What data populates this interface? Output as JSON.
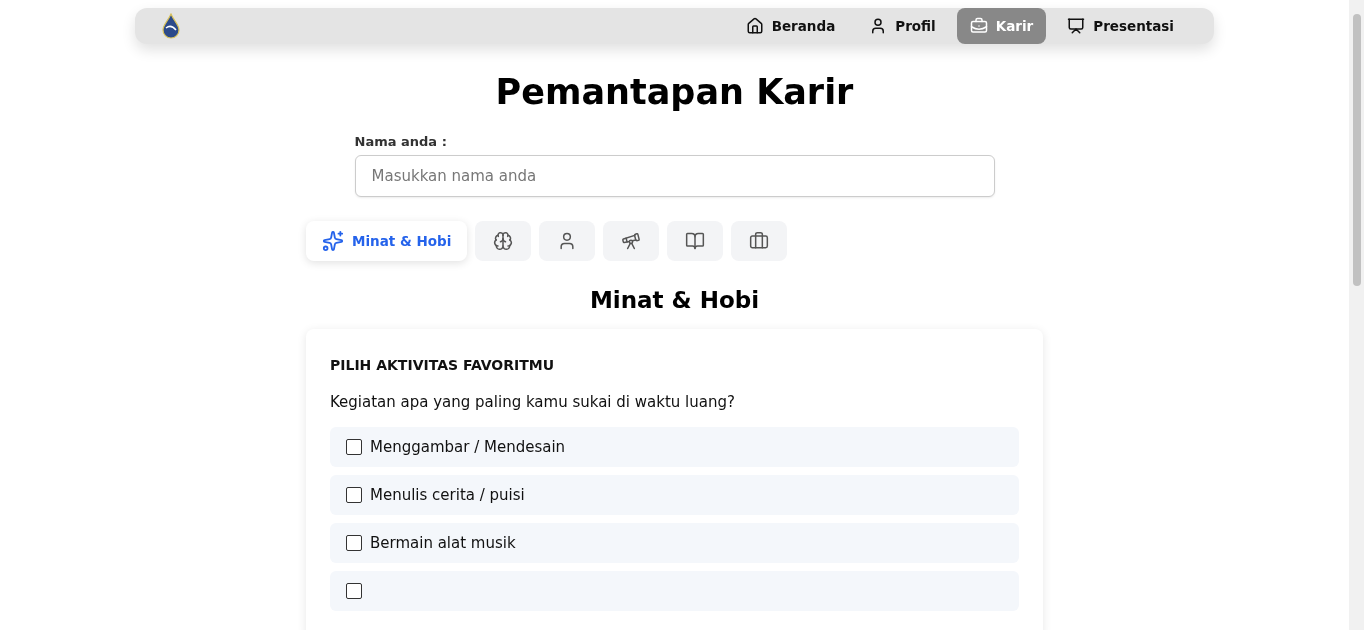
{
  "nav": {
    "items": [
      {
        "label": "Beranda",
        "selected": false
      },
      {
        "label": "Profil",
        "selected": false
      },
      {
        "label": "Karir",
        "selected": true
      },
      {
        "label": "Presentasi",
        "selected": false
      }
    ]
  },
  "title": "Pemantapan Karir",
  "name_field": {
    "label": "Nama anda :",
    "placeholder": "Masukkan nama anda"
  },
  "tabs": [
    {
      "label": "Minat & Hobi",
      "selected": true
    },
    {
      "selected": false
    },
    {
      "selected": false
    },
    {
      "selected": false
    },
    {
      "selected": false
    },
    {
      "selected": false
    }
  ],
  "section_title": "Minat & Hobi",
  "card": {
    "heading": "PILIH AKTIVITAS FAVORITMU",
    "question": "Kegiatan apa yang paling kamu sukai di waktu luang?",
    "options": [
      {
        "label": "Menggambar / Mendesain",
        "checked": false
      },
      {
        "label": "Menulis cerita / puisi",
        "checked": false
      },
      {
        "label": "Bermain alat musik",
        "checked": false
      },
      {
        "checked": false
      }
    ]
  }
}
